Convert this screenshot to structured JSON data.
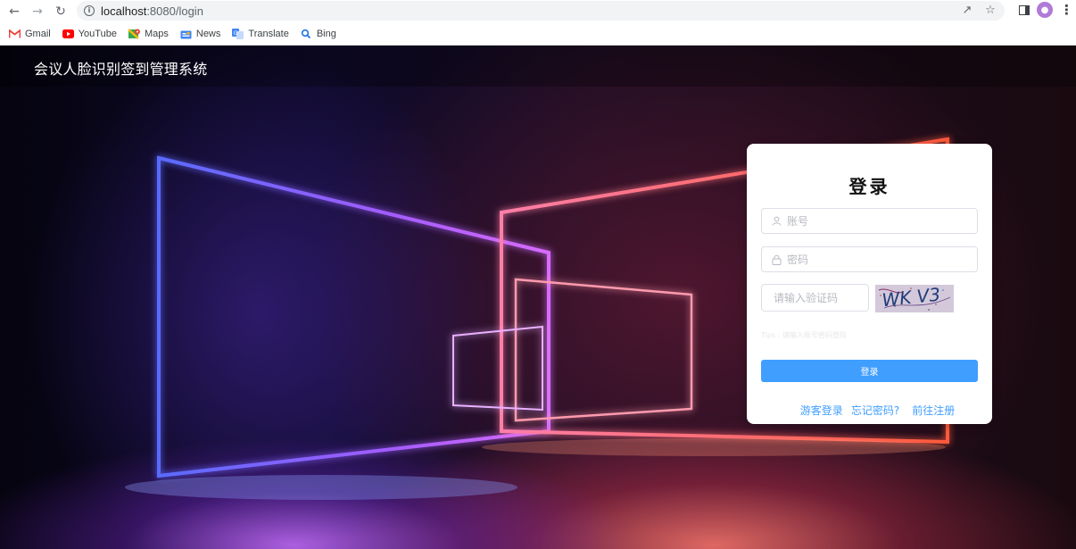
{
  "browser": {
    "url_host": "localhost",
    "url_path": ":8080/login",
    "bookmarks": [
      {
        "label": "Gmail",
        "icon": "gmail-icon"
      },
      {
        "label": "YouTube",
        "icon": "youtube-icon"
      },
      {
        "label": "Maps",
        "icon": "maps-icon"
      },
      {
        "label": "News",
        "icon": "news-icon"
      },
      {
        "label": "Translate",
        "icon": "translate-icon"
      },
      {
        "label": "Bing",
        "icon": "bing-search-icon"
      }
    ]
  },
  "header": {
    "title": "会议人脸识别签到管理系统"
  },
  "login": {
    "title": "登录",
    "account_placeholder": "账号",
    "password_placeholder": "密码",
    "captcha_placeholder": "请输入验证码",
    "captcha_text": "WK V3",
    "tips": "Tips : 请输入账号密码登陆",
    "submit_label": "登录",
    "guest_link": "游客登录",
    "forgot_link": "忘记密码?",
    "register_link": "前往注册"
  },
  "colors": {
    "primary": "#409eff",
    "card_bg": "#ffffff",
    "page_bg": "#0f0a2c"
  }
}
